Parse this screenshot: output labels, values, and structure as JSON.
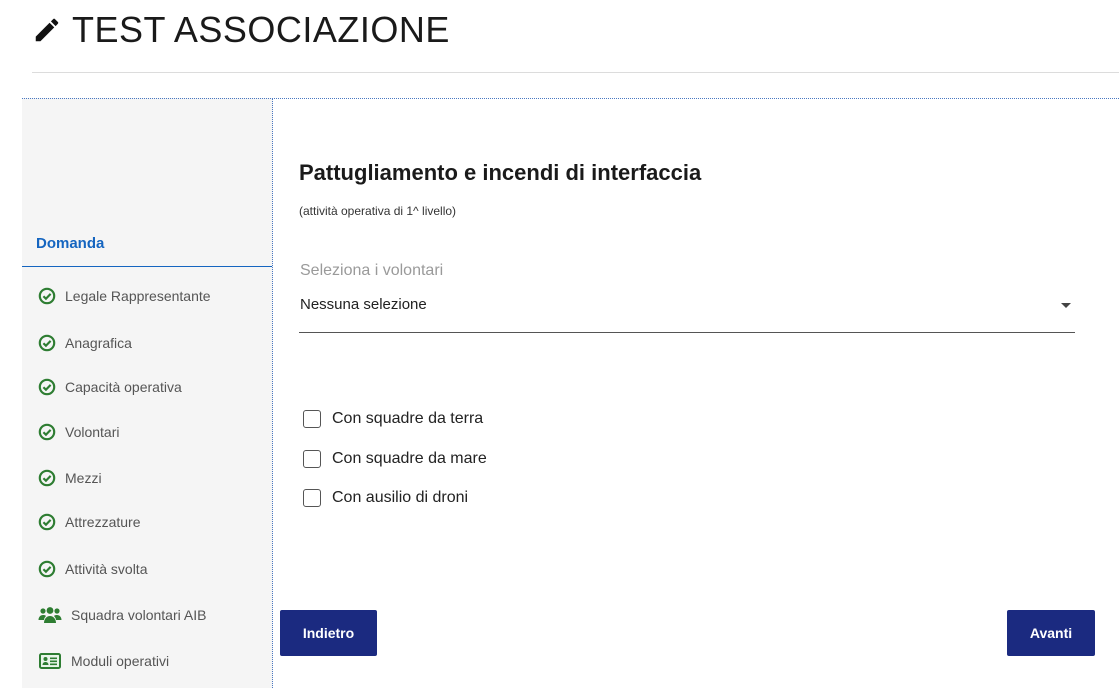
{
  "header": {
    "title": "TEST ASSOCIAZIONE",
    "icon": "pencil-icon"
  },
  "sidebar": {
    "heading": "Domanda",
    "items": [
      {
        "label": "Legale Rappresentante",
        "icon": "check-circle-icon"
      },
      {
        "label": "Anagrafica",
        "icon": "check-circle-icon"
      },
      {
        "label": "Capacità operativa",
        "icon": "check-circle-icon"
      },
      {
        "label": "Volontari",
        "icon": "check-circle-icon"
      },
      {
        "label": "Mezzi",
        "icon": "check-circle-icon"
      },
      {
        "label": "Attrezzature",
        "icon": "check-circle-icon"
      },
      {
        "label": "Attività svolta",
        "icon": "check-circle-icon"
      },
      {
        "label": "Squadra volontari AIB",
        "icon": "users-icon"
      },
      {
        "label": "Moduli operativi",
        "icon": "id-card-icon"
      }
    ]
  },
  "main": {
    "title": "Pattugliamento e incendi di interfaccia",
    "subtitle": "(attività operativa di 1^ livello)",
    "select": {
      "label": "Seleziona i volontari",
      "value": "Nessuna selezione"
    },
    "checkboxes": [
      {
        "label": "Con squadre da terra",
        "checked": false
      },
      {
        "label": "Con squadre da mare",
        "checked": false
      },
      {
        "label": "Con ausilio di droni",
        "checked": false
      }
    ],
    "back_label": "Indietro",
    "next_label": "Avanti"
  },
  "colors": {
    "accent": "#1565c0",
    "button": "#1b2a80",
    "success": "#2e7d32"
  }
}
